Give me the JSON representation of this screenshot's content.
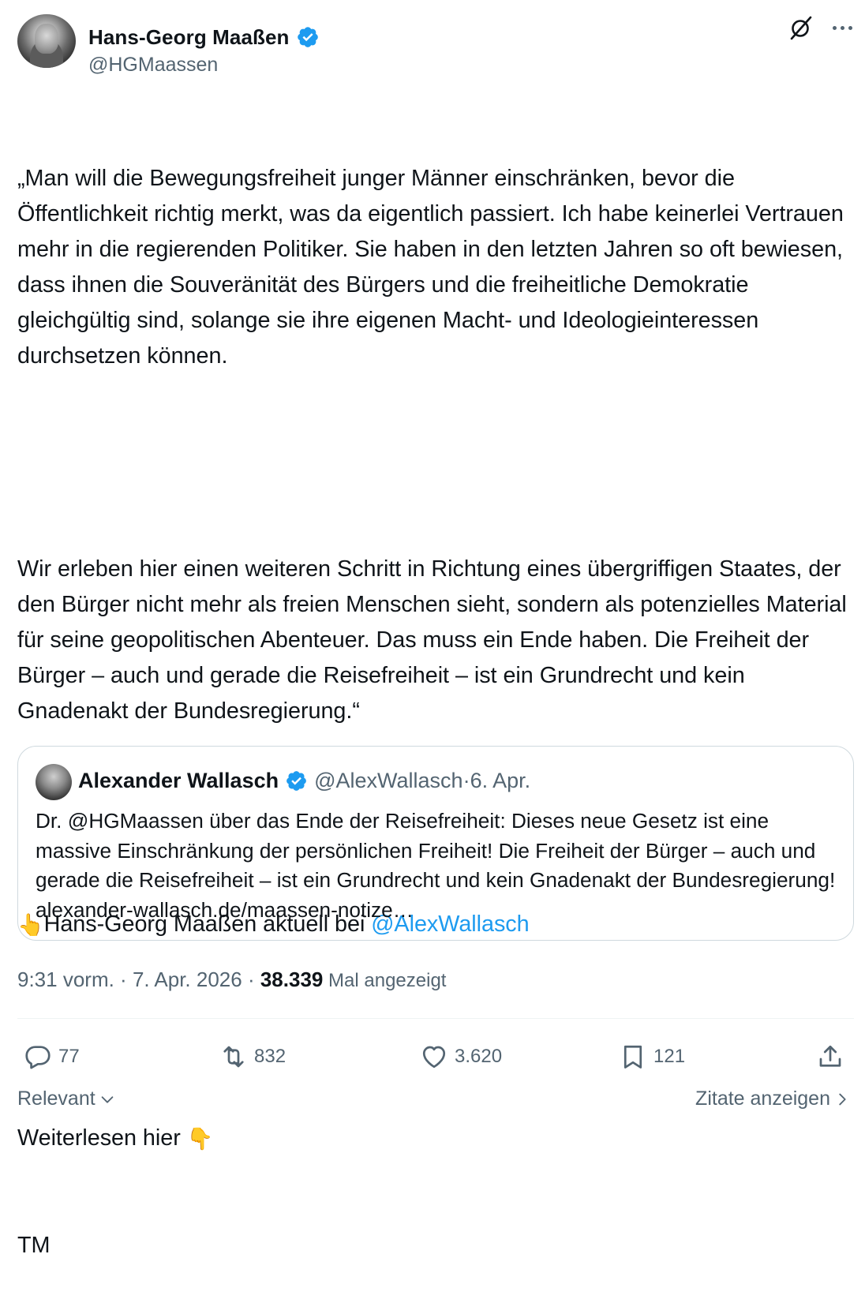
{
  "author": {
    "name": "Hans-Georg Maaßen",
    "handle": "@HGMaassen"
  },
  "post": {
    "paragraph1": "„Man will die Bewegungsfreiheit junger Männer einschränken, bevor die Öffentlichkeit richtig merkt, was da eigentlich passiert. Ich habe keinerlei Vertrauen mehr in die regierenden Politiker. Sie haben in den letzten Jahren so oft bewiesen, dass ihnen die Souveränität des Bürgers und die freiheitliche Demokratie gleichgültig sind, solange sie ihre eigenen Macht- und Ideologieinteressen durchsetzen können.",
    "paragraph2": "Wir erleben hier einen weiteren Schritt in Richtung eines übergriffigen Staates, der den Bürger nicht mehr als freien Menschen sieht, sondern als potenzielles Material für seine geopolitischen Abenteuer. Das muss ein Ende haben. Die Freiheit der Bürger – auch und gerade die Reisefreiheit – ist ein Grundrecht und kein Gnadenakt der Bundesregierung.“",
    "pointer_emoji": "👆",
    "line3_text": "Hans-Georg Maaßen aktuell bei ",
    "line3_mention": "@AlexWallasch",
    "line4_text": "Weiterlesen hier ",
    "down_emoji": "👇",
    "signature": "TM"
  },
  "quote": {
    "name": "Alexander Wallasch",
    "handle": "@AlexWallasch",
    "separator": " · ",
    "date": "6. Apr.",
    "text": "Dr. @HGMaassen über das Ende der Reisefreiheit: Dieses neue Gesetz ist eine massive Einschränkung der persönlichen Freiheit! Die Freiheit der Bürger – auch und gerade die Reisefreiheit – ist ein Grundrecht und kein Gnadenakt der Bundesregierung! alexander-wallasch.de/maassen-notize…"
  },
  "meta": {
    "time": "9:31 vorm.",
    "sep": " · ",
    "date": "7. Apr. 2026",
    "views_count": "38.339",
    "views_label": " Mal angezeigt"
  },
  "actions": {
    "replies": "77",
    "reposts": "832",
    "likes": "3.620",
    "bookmarks": "121"
  },
  "footer": {
    "sort_label": "Relevant",
    "quotes_label": "Zitate anzeigen"
  },
  "colors": {
    "accent": "#1d9bf0",
    "secondary_text": "#536471",
    "border": "#cfd9de"
  },
  "icons": [
    "verified-badge-icon",
    "grok-icon",
    "more-icon",
    "reply-icon",
    "repost-icon",
    "like-icon",
    "bookmark-icon",
    "share-icon",
    "chevron-down-icon",
    "chevron-right-icon"
  ]
}
